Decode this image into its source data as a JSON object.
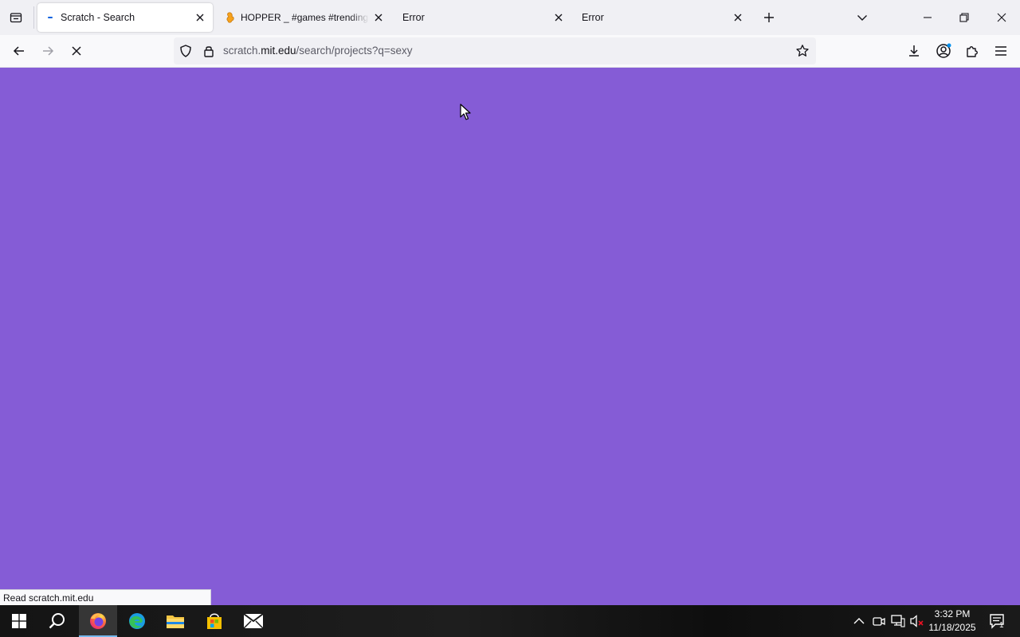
{
  "browser": {
    "tabs": [
      {
        "title": "Scratch - Search",
        "active": true,
        "favicon": "scratch-loading-icon"
      },
      {
        "title": "HOPPER _ #games #trending #all",
        "active": false,
        "favicon": "scratch-cat-icon"
      },
      {
        "title": "Error",
        "active": false,
        "favicon": "none"
      },
      {
        "title": "Error",
        "active": false,
        "favicon": "none"
      }
    ],
    "url": {
      "prefix": "scratch.",
      "host": "mit.edu",
      "path": "/search/projects?q=sexy"
    },
    "status_text": "Read scratch.mit.edu",
    "page_background": "#855cd6",
    "accent": "#0060df"
  },
  "taskbar": {
    "apps": [
      "start-icon",
      "search-icon",
      "firefox-icon",
      "edge-icon",
      "file-explorer-icon",
      "store-icon",
      "mail-icon"
    ],
    "clock": {
      "time": "3:32 PM",
      "date": "11/18/2025"
    },
    "notification_count": "1"
  }
}
